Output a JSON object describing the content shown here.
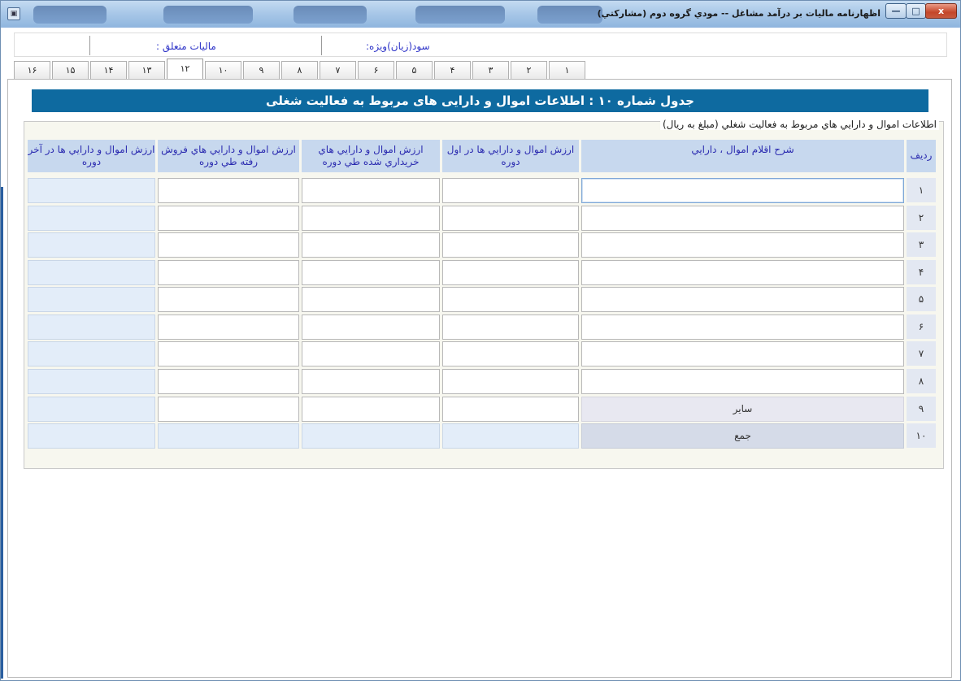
{
  "window": {
    "title": "اظهارنامه ماليات بر درآمد مشاغل --  مودي گروه دوم (مشاركتي)",
    "min_label": "—",
    "max_label": "□",
    "close_label": "x"
  },
  "header_fields": {
    "profit_label": "سود(زيان)ويژه:",
    "tax_label": "ماليات متعلق :"
  },
  "tabs": [
    "١۶",
    "١۵",
    "١۴",
    "١٣",
    "١٢",
    "١٠",
    "٩",
    "٨",
    "٧",
    "۶",
    "۵",
    "۴",
    "٣",
    "٢",
    "١"
  ],
  "active_tab": "١٢",
  "table_title": "جدول شماره ۱۰ : اطلاعات اموال و دارایی های مربوط به فعالیت شغلی",
  "group_label": "اطلاعات اموال و دارايي هاي مربوط به فعاليت شغلي (مبلغ به ريال)",
  "columns": {
    "row": "رديف",
    "description": "شرح اقلام اموال ، دارايي",
    "start_value": "ارزش اموال و دارايي ها در اول دوره",
    "purchased": "ارزش اموال و دارايي هاي خريداري شده طي دوره",
    "sold": "ارزش اموال و دارايي هاي فروش رفته طي دوره",
    "end_value": "ارزش اموال و دارايي ها در آخر دوره"
  },
  "rows": [
    {
      "num": "١",
      "desc": ""
    },
    {
      "num": "٢",
      "desc": ""
    },
    {
      "num": "٣",
      "desc": ""
    },
    {
      "num": "۴",
      "desc": ""
    },
    {
      "num": "۵",
      "desc": ""
    },
    {
      "num": "۶",
      "desc": ""
    },
    {
      "num": "٧",
      "desc": ""
    },
    {
      "num": "٨",
      "desc": ""
    },
    {
      "num": "٩",
      "desc": "ساير"
    },
    {
      "num": "١٠",
      "desc": "جمع"
    }
  ],
  "colors": {
    "heading_bg": "#0e6aa0",
    "header_cell_bg": "#c7d8ee",
    "readonly_cell_bg": "#e3edf9",
    "label_text": "#2f35c8"
  }
}
